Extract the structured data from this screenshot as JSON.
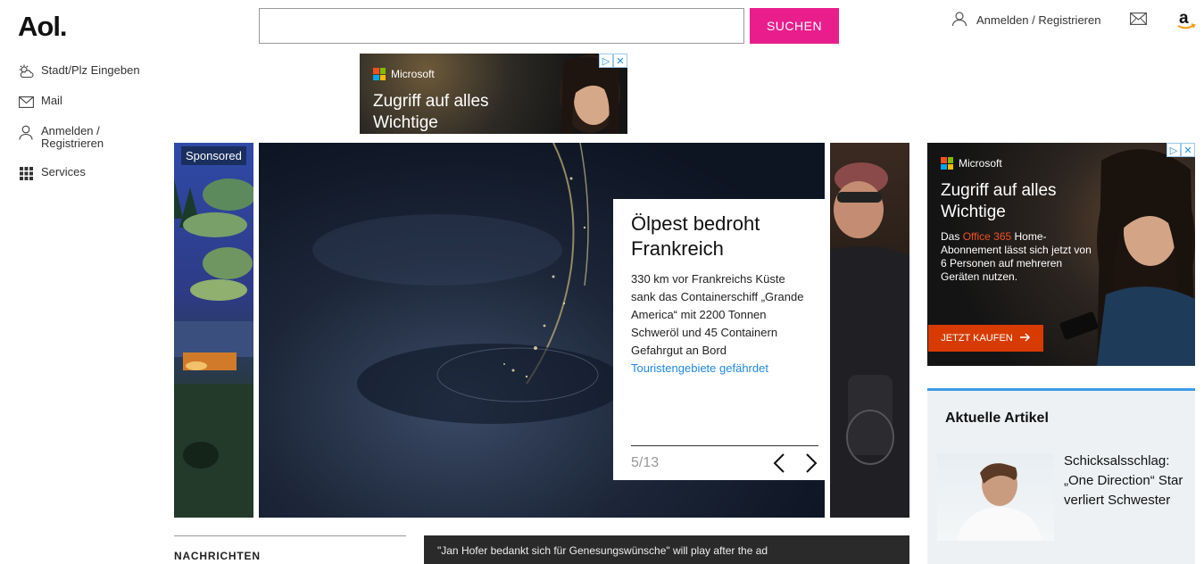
{
  "header": {
    "logo": "Aol.",
    "search": {
      "value": "",
      "placeholder": "",
      "button_label": "SUCHEN"
    },
    "user_link": "Anmelden / Registrieren",
    "mail_icon": "mail-icon",
    "amazon_icon": "amazon-icon",
    "accent_color": "#e91e8c"
  },
  "sidebar": {
    "items": [
      {
        "label": "Stadt/Plz Eingeben",
        "icon": "weather-icon"
      },
      {
        "label": "Mail",
        "icon": "mail-icon"
      },
      {
        "label": "Anmelden /\nRegistrieren",
        "icon": "user-icon"
      },
      {
        "label": "Services",
        "icon": "grid-icon"
      }
    ]
  },
  "ad_top": {
    "brand": "Microsoft",
    "headline": "Zugriff auf alles Wichtige"
  },
  "carousel": {
    "sponsored_label": "Sponsored",
    "story": {
      "title": "Ölpest bedroht Frankreich",
      "text": "330 km vor Frankreichs Küste sank das Containerschiff „Grande America“ mit 2200 Tonnen Schweröl und 45 Containern Gefahrgut an Bord",
      "link": "Touristengebiete gefährdet",
      "counter": "5/13"
    }
  },
  "ad_right": {
    "brand": "Microsoft",
    "headline": "Zugriff auf alles Wichtige",
    "body_before": "Das ",
    "body_highlight": "Office 365",
    "body_after": " Home-Abonnement lässt sich jetzt von 6 Personen auf mehreren Geräten nutzen.",
    "cta": "JETZT KAUFEN",
    "cta_color": "#d83b01"
  },
  "articles": {
    "title": "Aktuelle Artikel",
    "items": [
      {
        "text": "Schicksalsschlag: „One Direction“ Star verliert Schwester"
      }
    ],
    "accent_color": "#3b9be5"
  },
  "news": {
    "section_label": "NACHRICHTEN",
    "video_notice": "\"Jan Hofer bedankt sich für Genesungswünsche\" will play after the ad"
  }
}
